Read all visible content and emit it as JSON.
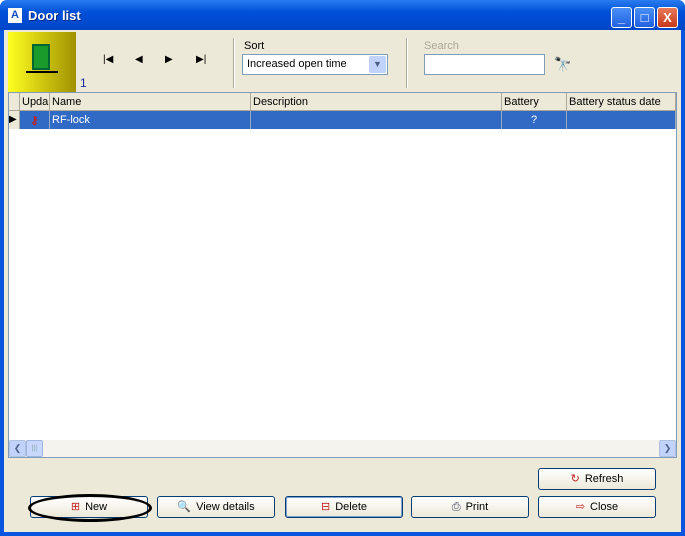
{
  "window": {
    "title": "Door list",
    "minimize": "_",
    "maximize": "□",
    "close": "X"
  },
  "toolbar": {
    "record_count": "1",
    "nav": {
      "first": "|◀",
      "prev": "◀",
      "next": "▶",
      "last": "▶|"
    },
    "sort_label": "Sort",
    "sort_value": "Increased open time",
    "search_label": "Search",
    "search_value": ""
  },
  "grid": {
    "columns": [
      "Upda",
      "Name",
      "Description",
      "Battery",
      "Battery status date"
    ],
    "rows": [
      {
        "update": "",
        "name": "RF-lock",
        "description": "",
        "battery": "?",
        "battery_status_date": ""
      }
    ]
  },
  "buttons": {
    "refresh": "Refresh",
    "new": "New",
    "view_details": "View details",
    "delete": "Delete",
    "print": "Print",
    "close": "Close"
  }
}
